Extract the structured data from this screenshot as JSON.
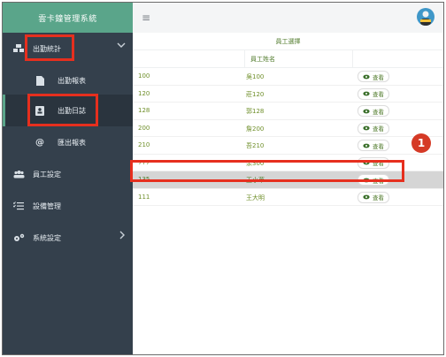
{
  "app": {
    "title": "雲卡鐘管理系統"
  },
  "sidebar": {
    "items": [
      {
        "label": "出勤統計",
        "icon": "cubes-icon"
      },
      {
        "label": "出勤報表",
        "icon": "file-icon"
      },
      {
        "label": "出勤日誌",
        "icon": "contact-card-icon"
      },
      {
        "label": "匯出報表",
        "icon": "at-icon"
      },
      {
        "label": "員工設定",
        "icon": "users-icon"
      },
      {
        "label": "設備管理",
        "icon": "checklist-icon"
      },
      {
        "label": "系統設定",
        "icon": "gears-icon"
      }
    ]
  },
  "topbar": {
    "menu_icon": "≡",
    "avatar": "avatar"
  },
  "table": {
    "group_header": "員工選擇",
    "name_header": "員工姓名",
    "view_label": "查看",
    "rows": [
      {
        "id": "100",
        "name": "吳100"
      },
      {
        "id": "120",
        "name": "莊120"
      },
      {
        "id": "128",
        "name": "郭128"
      },
      {
        "id": "200",
        "name": "詹200"
      },
      {
        "id": "210",
        "name": "吾210"
      },
      {
        "id": "777",
        "name": "余300"
      },
      {
        "id": "135",
        "name": "王小華"
      },
      {
        "id": "111",
        "name": "王大明"
      }
    ],
    "selected_index": 6
  },
  "annotation": {
    "step": "1"
  },
  "colors": {
    "sidebar": "#34404c",
    "brand": "#5aa58a",
    "highlight": "#e62f1e",
    "text_green": "#4f7a2a"
  }
}
